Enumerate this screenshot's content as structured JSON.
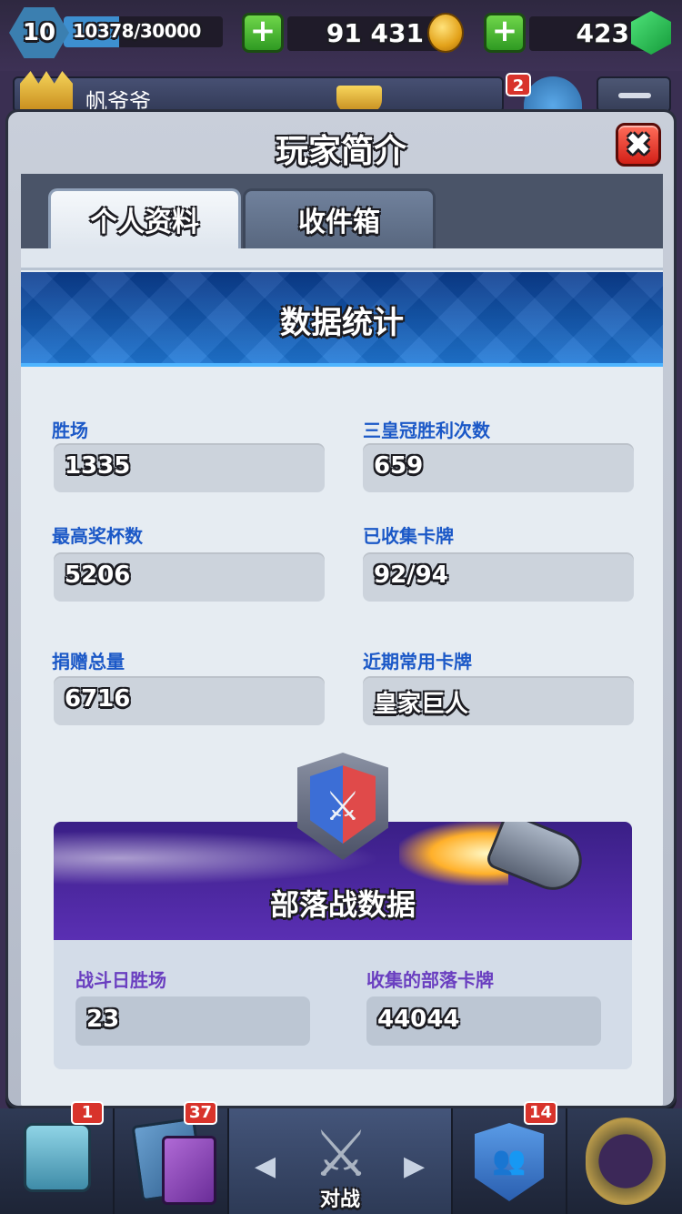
{
  "topbar": {
    "level": "10",
    "xp_text": "10378/30000",
    "xp_progress": 0.346,
    "gold": "91 431",
    "gems": "423"
  },
  "player_row": {
    "name": "帆爷爷",
    "notification_count": "2"
  },
  "dialog": {
    "title": "玩家简介",
    "close_label": "✖",
    "tabs": [
      {
        "label": "个人资料",
        "active": true
      },
      {
        "label": "收件箱",
        "active": false
      }
    ],
    "stats_title": "数据统计",
    "stats": [
      {
        "label": "胜场",
        "value": "1335"
      },
      {
        "label": "三皇冠胜利次数",
        "value": "659"
      },
      {
        "label": "最高奖杯数",
        "value": "5206"
      },
      {
        "label": "已收集卡牌",
        "value": "92/94"
      },
      {
        "label": "捐赠总量",
        "value": "6716"
      },
      {
        "label": "近期常用卡牌",
        "value": "皇家巨人"
      }
    ],
    "clan_war": {
      "title": "部落战数据",
      "stats": [
        {
          "label": "战斗日胜场",
          "value": "23"
        },
        {
          "label": "收集的部落卡牌",
          "value": "44044"
        }
      ]
    }
  },
  "bottom_nav": {
    "shop_badge": "1",
    "cards_badge": "37",
    "battle_label": "对战",
    "clan_badge": "14"
  },
  "colors": {
    "label_blue": "#1b58c7",
    "clan_purple": "#5a2fb3",
    "close_red": "#d21f17",
    "plus_green": "#2f9a22"
  }
}
